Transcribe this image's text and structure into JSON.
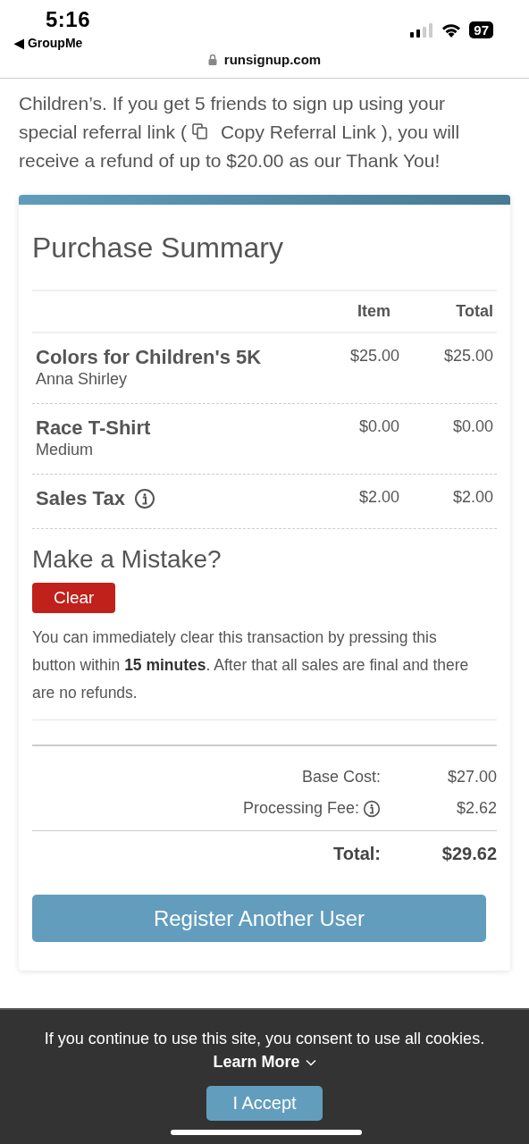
{
  "status_bar": {
    "time": "5:16",
    "back_app": "◀ GroupMe",
    "battery": "97",
    "url": "runsignup.com"
  },
  "intro": {
    "before_link": "Children’s. If you get 5 friends to sign up using your special referral link (",
    "link": "Copy Referral Link",
    "after_link": " ), you will receive a refund of up to $20.00 as our Thank You!"
  },
  "summary": {
    "title": "Purchase Summary",
    "columns": [
      "Item",
      "Total"
    ],
    "rows": [
      {
        "name": "Colors for Children's 5K",
        "detail": "Anna Shirley",
        "item": "$25.00",
        "total": "$25.00",
        "info": false
      },
      {
        "name": "Race T-Shirt",
        "detail": "Medium",
        "item": "$0.00",
        "total": "$0.00",
        "info": false
      },
      {
        "name": "Sales Tax",
        "item": "$2.00",
        "total": "$2.00",
        "info": true
      }
    ]
  },
  "mistake": {
    "title": "Make a Mistake?",
    "button": "Clear",
    "text": "You can immediately clear this transaction by pressing this button within **15 minutes**. After that all sales are final and there are no refunds."
  },
  "totals": [
    {
      "label": "Base Cost:",
      "value": "$27.00",
      "info": false,
      "kind": "normal"
    },
    {
      "label": "Processing Fee:",
      "value": "$2.62",
      "info": true,
      "kind": "normal"
    },
    {
      "label": "Total:",
      "value": "$29.62",
      "info": false,
      "kind": "grand"
    }
  ],
  "register_button": "Register Another User",
  "cookie": {
    "text": "If you continue to use this site, you consent to use all cookies.",
    "learn_more": "Learn More",
    "accept": "I Accept"
  }
}
